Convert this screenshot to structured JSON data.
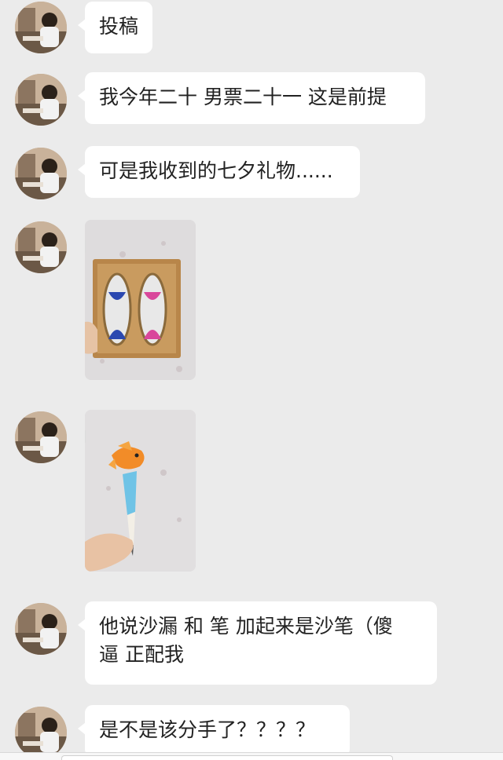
{
  "messages": [
    {
      "type": "text",
      "text": "投稿"
    },
    {
      "type": "text",
      "text": "我今年二十 男票二十一 这是前提"
    },
    {
      "type": "text",
      "text": "可是我收到的七夕礼物......"
    },
    {
      "type": "image",
      "icon": "hourglass-photo"
    },
    {
      "type": "image",
      "icon": "fish-pen-photo"
    },
    {
      "type": "text",
      "line1": "他说沙漏 和 笔 加起来是沙笔（傻",
      "line2": "逼   正配我"
    },
    {
      "type": "text",
      "text": "是不是该分手了？？？？"
    }
  ],
  "colors": {
    "background": "#ebebeb",
    "bubble": "#ffffff",
    "text": "#222222"
  }
}
